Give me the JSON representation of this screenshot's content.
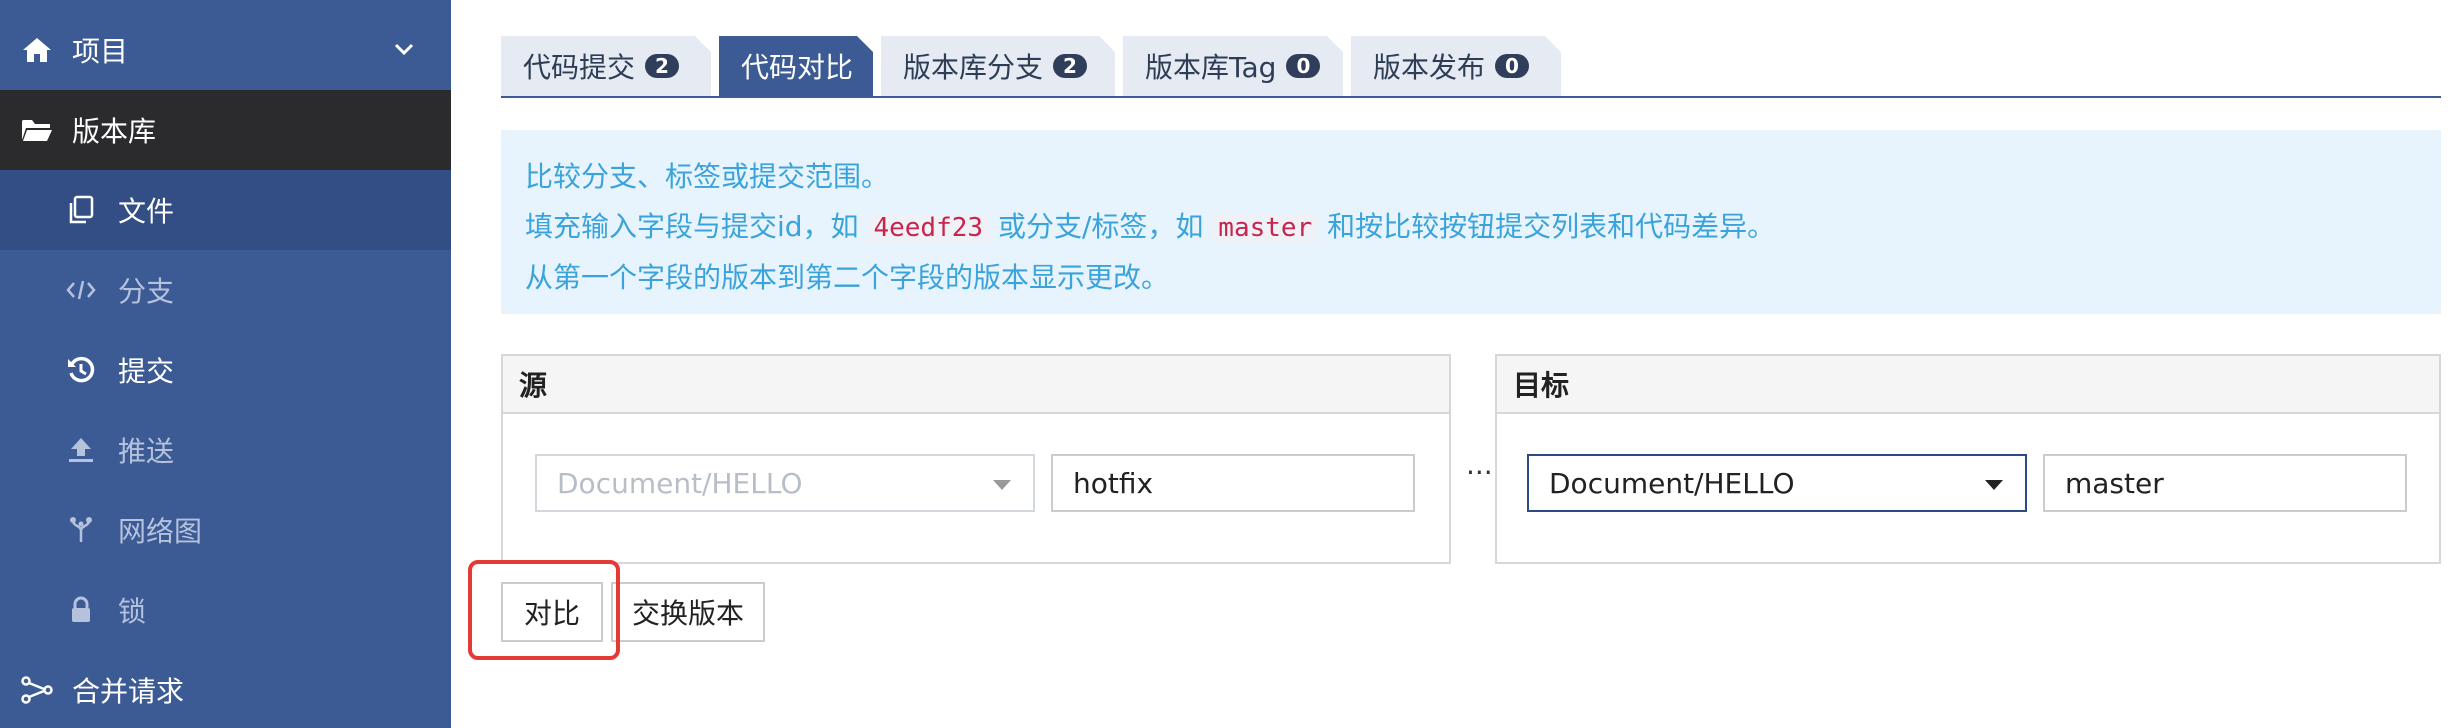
{
  "sidebar": {
    "items": [
      {
        "label": "项目",
        "icon": "home-icon"
      },
      {
        "label": "版本库",
        "icon": "folder-open-icon"
      },
      {
        "label": "文件",
        "icon": "files-icon"
      },
      {
        "label": "分支",
        "icon": "code-icon"
      },
      {
        "label": "提交",
        "icon": "history-icon"
      },
      {
        "label": "推送",
        "icon": "upload-icon"
      },
      {
        "label": "网络图",
        "icon": "fork-icon"
      },
      {
        "label": "锁",
        "icon": "lock-icon"
      },
      {
        "label": "合并请求",
        "icon": "merge-icon"
      }
    ]
  },
  "tabs": [
    {
      "label": "代码提交",
      "count": "2"
    },
    {
      "label": "代码对比"
    },
    {
      "label": "版本库分支",
      "count": "2"
    },
    {
      "label": "版本库Tag",
      "count": "0"
    },
    {
      "label": "版本发布",
      "count": "0"
    }
  ],
  "info": {
    "line1": "比较分支、标签或提交范围。",
    "line2_a": "填充输入字段与提交id，如",
    "line2_code1": "4eedf23",
    "line2_b": "或分支/标签，如",
    "line2_code2": "master",
    "line2_c": "和按比较按钮提交列表和代码差异。",
    "line3": "从第一个字段的版本到第二个字段的版本显示更改。"
  },
  "source": {
    "title": "源",
    "repo": "Document/HELLO",
    "ref": "hotfix"
  },
  "separator": "...",
  "target": {
    "title": "目标",
    "repo": "Document/HELLO",
    "ref": "master"
  },
  "buttons": {
    "compare": "对比",
    "swap": "交换版本"
  },
  "colors": {
    "sidebar": "#3c5a94",
    "sidebar_active": "#2b2b2d",
    "info_bg": "#e8f4fd",
    "info_text": "#3aa3db",
    "highlight": "#e53935"
  }
}
